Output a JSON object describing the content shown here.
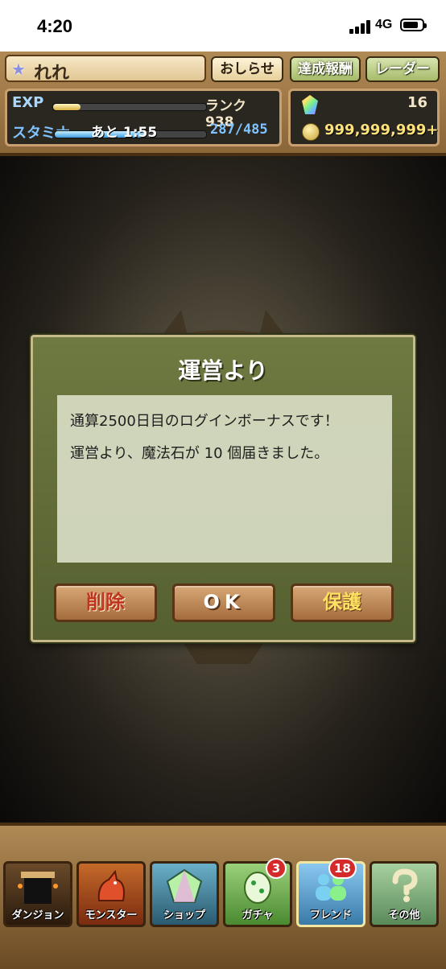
{
  "status_bar": {
    "time": "4:20",
    "network": "4G"
  },
  "hud": {
    "player_name": "れれ",
    "buttons": {
      "news": "おしらせ",
      "achievements": "達成報酬",
      "radar": "レーダー"
    },
    "exp_label": "EXP",
    "exp_fill": 0.18,
    "rank": "ランク 938",
    "stamina_label": "スタミナ",
    "stamina_timer": "あと 1:55",
    "stamina_fill": 0.59,
    "stamina_value": "287/485",
    "magic_stones": "16",
    "coins": "999,999,999+"
  },
  "dialog": {
    "title": "運営より",
    "line1": "通算2500日目のログインボーナスです！",
    "line2": "運営より、魔法石が 10 個届きました。",
    "delete_label": "削除",
    "ok_label": "OK",
    "keep_label": "保護"
  },
  "nav": {
    "items": [
      {
        "label": "ダンジョン",
        "icon": "dungeon-gate-icon"
      },
      {
        "label": "モンスター",
        "icon": "dragon-icon"
      },
      {
        "label": "ショップ",
        "icon": "magic-stone-icon"
      },
      {
        "label": "ガチャ",
        "icon": "egg-icon"
      },
      {
        "label": "フレンド",
        "icon": "friends-icon"
      },
      {
        "label": "その他",
        "icon": "question-icon"
      }
    ],
    "gacha_badge": "3",
    "friend_badge": "18"
  },
  "colors": {
    "dialog_bg": "#5f6a38",
    "button_brown": "#b57a48",
    "delete_red": "#c0331e",
    "keep_yellow": "#ffe060",
    "badge_red": "#d42a2a"
  }
}
